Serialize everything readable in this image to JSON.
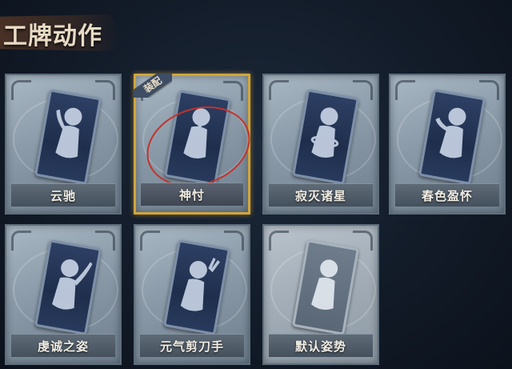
{
  "header": {
    "title": "工牌动作"
  },
  "cards": [
    {
      "label": "云驰",
      "icon": "pose-cloud-icon"
    },
    {
      "label": "神忖",
      "icon": "pose-thinking-icon",
      "badge": "装配",
      "selected": true
    },
    {
      "label": "寂灭诸星",
      "icon": "pose-star-icon"
    },
    {
      "label": "春色盈怀",
      "icon": "pose-embrace-icon"
    },
    {
      "label": "虔诚之姿",
      "icon": "pose-prayer-icon"
    },
    {
      "label": "元气剪刀手",
      "icon": "pose-peace-sign-icon"
    },
    {
      "label": "默认姿势",
      "icon": "pose-default-icon",
      "default": true
    }
  ],
  "colors": {
    "selected_border": "#d2a53b",
    "annotation_circle": "#c2332c",
    "badge_bg": "#3e4d64"
  }
}
